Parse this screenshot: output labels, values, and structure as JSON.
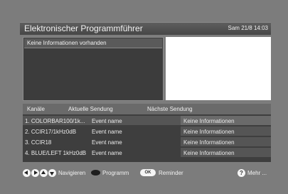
{
  "header": {
    "title": "Elektronischer Programmführer",
    "datetime": "Sam 21/8 14:03"
  },
  "info": {
    "text": "Keine Informationen vorhanden"
  },
  "list": {
    "columns": {
      "channels": "Kanäle",
      "current": "Aktuelle Sendung",
      "next": "Nächste Sendung"
    },
    "rows": [
      {
        "channel": "1. COLORBAR100/1k...",
        "current": "Event name",
        "next": "Keine Informationen"
      },
      {
        "channel": "2. CCIR17/1kHz0dB",
        "current": "Event name",
        "next": "Keine Informationen"
      },
      {
        "channel": "3. CCIR18",
        "current": "Event name",
        "next": "Keine Informationen"
      },
      {
        "channel": "4. BLUE/LEFT 1kHz0dB",
        "current": "Event name",
        "next": "Keine Informationen"
      }
    ]
  },
  "footer": {
    "navigate_label": "Navigieren",
    "program_label": "Programm",
    "ok_badge": "OK",
    "reminder_label": "Reminder",
    "help_glyph": "?",
    "more_label": "Mehr ...",
    "icons": [
      "arrow-left-icon",
      "arrow-right-icon",
      "arrow-up-icon",
      "arrow-down-icon",
      "dark-button-icon",
      "ok-button-icon",
      "help-icon"
    ]
  },
  "colors": {
    "background": "#7c7c7c",
    "panel": "#3e3e3e",
    "preview": "#ffffff"
  }
}
